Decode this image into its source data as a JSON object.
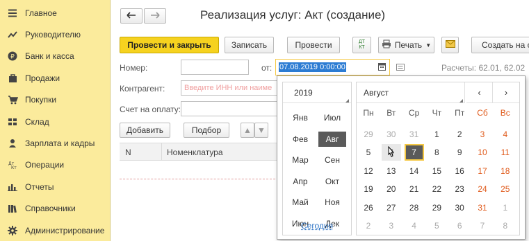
{
  "sidebar": {
    "items": [
      {
        "icon": "menu-icon",
        "label": "Главное"
      },
      {
        "icon": "trend-icon",
        "label": "Руководителю"
      },
      {
        "icon": "ruble-icon",
        "label": "Банк и касса"
      },
      {
        "icon": "bag-icon",
        "label": "Продажи"
      },
      {
        "icon": "cart-icon",
        "label": "Покупки"
      },
      {
        "icon": "warehouse-icon",
        "label": "Склад"
      },
      {
        "icon": "person-icon",
        "label": "Зарплата и кадры"
      },
      {
        "icon": "dt-kt-icon",
        "label": "Операции"
      },
      {
        "icon": "bar-chart-icon",
        "label": "Отчеты"
      },
      {
        "icon": "books-icon",
        "label": "Справочники"
      },
      {
        "icon": "gear-icon",
        "label": "Администрирование"
      }
    ]
  },
  "header": {
    "title": "Реализация услуг: Акт (создание)"
  },
  "toolbar": {
    "post_close": "Провести и закрыть",
    "save": "Записать",
    "post": "Провести",
    "dtkt_top": "ДТ",
    "dtkt_bottom": "КТ",
    "print": "Печать",
    "create_based": "Создать на ос"
  },
  "form": {
    "number_label": "Номер:",
    "number_value": "",
    "from_label": "от:",
    "date_value": "07.08.2019  0:00:00",
    "accounts_text": "Расчеты: 62.01, 62.02",
    "counterparty_label": "Контрагент:",
    "counterparty_placeholder": "Введите ИНН или наиме",
    "invoice_label": "Счет на оплату:",
    "invoice_value": ""
  },
  "table": {
    "add_label": "Добавить",
    "pick_label": "Подбор",
    "columns": [
      "N",
      "Номенклатура"
    ]
  },
  "calendar": {
    "year": "2019",
    "month": "Август",
    "prev": "‹",
    "next": "›",
    "months": [
      [
        "Янв",
        "Июл"
      ],
      [
        "Фев",
        "Авг"
      ],
      [
        "Мар",
        "Сен"
      ],
      [
        "Апр",
        "Окт"
      ],
      [
        "Май",
        "Ноя"
      ],
      [
        "Июн",
        "Дек"
      ]
    ],
    "active_month": "Авг",
    "today_label": "Сегодня",
    "weekdays": [
      "Пн",
      "Вт",
      "Ср",
      "Чт",
      "Пт",
      "Сб",
      "Вс"
    ],
    "weeks": [
      [
        "29",
        "30",
        "31",
        "1",
        "2",
        "3",
        "4"
      ],
      [
        "5",
        "6",
        "7",
        "8",
        "9",
        "10",
        "11"
      ],
      [
        "12",
        "13",
        "14",
        "15",
        "16",
        "17",
        "18"
      ],
      [
        "19",
        "20",
        "21",
        "22",
        "23",
        "24",
        "25"
      ],
      [
        "26",
        "27",
        "28",
        "29",
        "30",
        "31",
        "1"
      ],
      [
        "2",
        "3",
        "4",
        "5",
        "6",
        "7",
        "8"
      ]
    ],
    "selected_day": "7",
    "colors": {
      "weekend": "#e05a1b",
      "selected_bg": "#5a5a5a",
      "selected_border": "#f5c842"
    }
  },
  "colors": {
    "sidebar_bg": "#fbeb9c",
    "primary_button": "#f6d21f",
    "link": "#2b72c4"
  }
}
